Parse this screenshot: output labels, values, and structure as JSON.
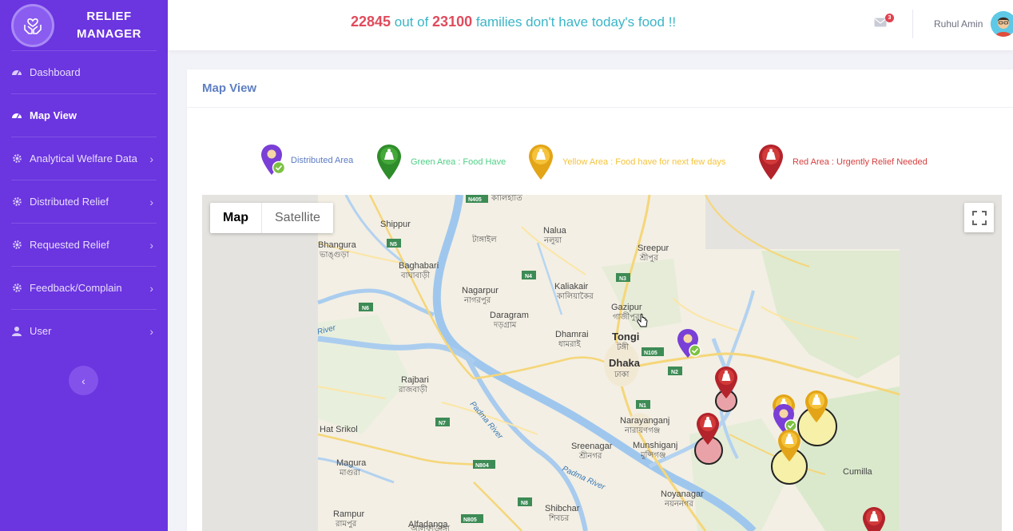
{
  "brand": {
    "line1": "RELIEF",
    "line2": "MANAGER"
  },
  "sidebar": {
    "items": [
      {
        "label": "Dashboard",
        "icon": "dashboard-icon",
        "has_arrow": false
      },
      {
        "label": "Map View",
        "icon": "dashboard-icon",
        "has_arrow": false,
        "active": true
      },
      {
        "label": "Analytical Welfare Data",
        "icon": "gear-icon",
        "has_arrow": true
      },
      {
        "label": "Distributed Relief",
        "icon": "gear-icon",
        "has_arrow": true
      },
      {
        "label": "Requested Relief",
        "icon": "gear-icon",
        "has_arrow": true
      },
      {
        "label": "Feedback/Complain",
        "icon": "gear-icon",
        "has_arrow": true
      },
      {
        "label": "User",
        "icon": "user-icon",
        "has_arrow": true
      }
    ],
    "collapse_icon": "chevron-left-icon",
    "collapse_glyph": "‹"
  },
  "header": {
    "count_without_food": "22845",
    "text_out_of": " out of ",
    "total_families": "23100",
    "text_suffix": " families don't have today's food !!",
    "notification_count": "3",
    "user_name": "Ruhul Amin"
  },
  "panel": {
    "title": "Map View"
  },
  "legend": [
    {
      "label": "Distributed Area",
      "color": "#5b7bc4",
      "marker": "purple-check-pin-icon"
    },
    {
      "label": "Green Area : Food Have",
      "color": "#4fcf86",
      "marker": "green-pin-icon"
    },
    {
      "label": "Yellow Area : Food have for next few days",
      "color": "#f5c33b",
      "marker": "yellow-pin-icon"
    },
    {
      "label": "Red Area : Urgently Relief Needed",
      "color": "#d64040",
      "marker": "red-pin-icon"
    }
  ],
  "map": {
    "type_buttons": [
      "Map",
      "Satellite"
    ],
    "active_type": "Map",
    "fullscreen_icon": "fullscreen-icon",
    "places": {
      "shippur": "Shippur",
      "bhangura": "Bhangura",
      "bhangura_bn": "ভাঙ্গুড়া",
      "baghabari": "Baghabari",
      "baghabari_bn": "বাঘাবাড়ী",
      "nagarpur": "Nagarpur",
      "nagarpur_bn": "নাগরপুর",
      "daragram": "Daragram",
      "daragram_bn": "দড়গ্রাম",
      "kaliakair": "Kaliakair",
      "kaliakair_bn": "কালিয়াকৈর",
      "gazipur": "Gazipur",
      "gazipur_bn": "গাজীপুর",
      "sreepur": "Sreepur",
      "sreepur_bn": "শ্রীপুর",
      "nalua": "Nalua",
      "nalua_bn": "নলুয়া",
      "tangail_bn": "টাঙ্গাইল",
      "kaliahati_bn": "কালিহাতি",
      "dhamrai": "Dhamrai",
      "dhamrai_bn": "ধামরাই",
      "tongi": "Tongi",
      "tongi_bn": "টঙ্গী",
      "dhaka": "Dhaka",
      "dhaka_bn": "ঢাকা",
      "rajbari": "Rajbari",
      "rajbari_bn": "রাজবাড়ী",
      "narayanganj": "Narayanganj",
      "narayanganj_bn": "নারায়ণগঞ্জ",
      "sreenagar": "Sreenagar",
      "sreenagar_bn": "শ্রীনগর",
      "munshiganj": "Munshiganj",
      "munshiganj_bn": "মুন্সিগঞ্জ",
      "hat_srikol": "Hat Srikol",
      "magura": "Magura",
      "magura_bn": "মাগুরা",
      "rampur": "Rampur",
      "rampur_bn": "রামপুর",
      "alfadanga": "Alfadanga",
      "alfadanga_bn": "আলফাডাঙ্গা",
      "shibchar": "Shibchar",
      "shibchar_bn": "শিবচর",
      "noyanagar": "Noyanagar",
      "noyanagar_bn": "নয়ননগর",
      "cumilla": "Cumilla"
    },
    "roads": {
      "n405": "N405",
      "n5": "N5",
      "n4": "N4",
      "n3": "N3",
      "n6": "N6",
      "n105": "N105",
      "n2": "N2",
      "n1": "N1",
      "n7": "N7",
      "n8": "N8",
      "n804": "N804",
      "n805": "N805"
    },
    "rivers": {
      "padma1": "Padma River",
      "padma2": "Padma River",
      "river": "River"
    }
  }
}
